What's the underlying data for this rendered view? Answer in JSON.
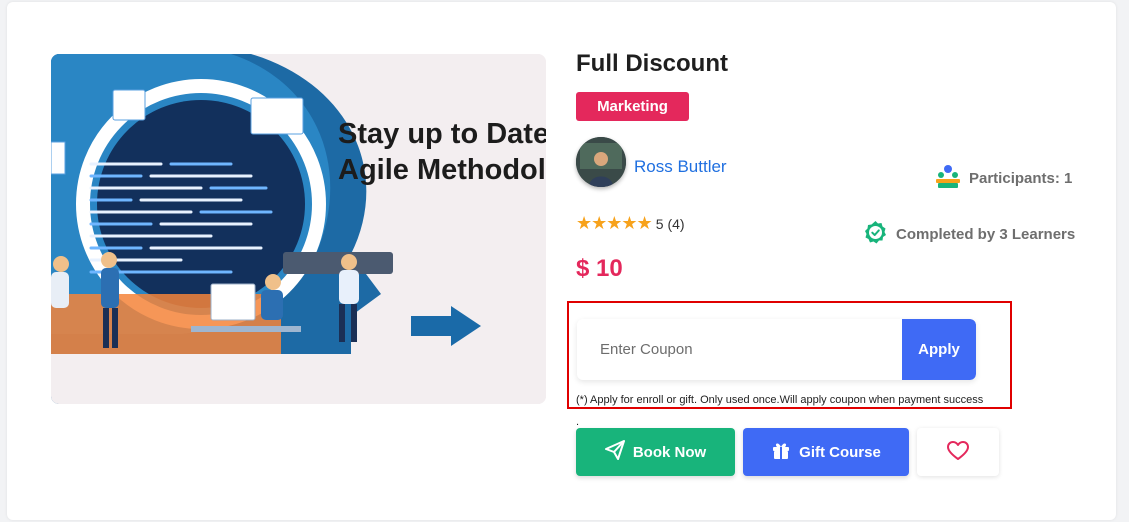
{
  "course": {
    "title": "Full Discount",
    "category": "Marketing",
    "image_text_line1": "Stay up to Date",
    "image_text_line2": "Agile Methodol",
    "instructor": "Ross Buttler",
    "rating": {
      "stars": 5,
      "value": "5",
      "count": "(4)"
    },
    "price": "$ 10",
    "participants_label": "Participants: 1",
    "completed_label": "Completed by 3 Learners"
  },
  "coupon": {
    "placeholder": "Enter Coupon",
    "value": "",
    "apply_label": "Apply",
    "note": "(*) Apply for enroll or gift. Only used once.Will apply coupon when payment success ."
  },
  "actions": {
    "book_label": "Book Now",
    "gift_label": "Gift Course",
    "wishlist_icon": "heart-icon"
  },
  "colors": {
    "accent_pink": "#e4285c",
    "primary_blue": "#3f6af5",
    "success_green": "#18b47b",
    "link_blue": "#1f6fe0",
    "highlight_red": "#e00000"
  }
}
